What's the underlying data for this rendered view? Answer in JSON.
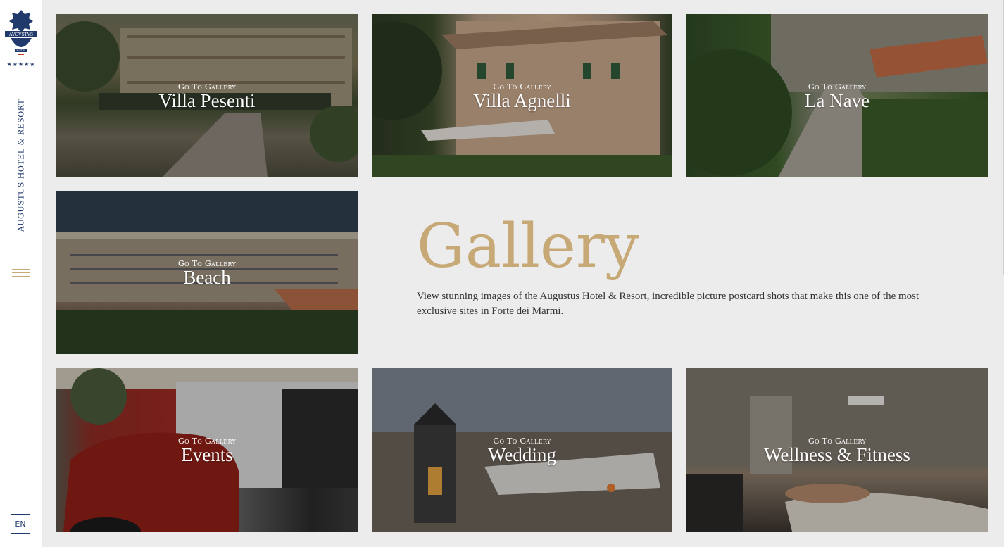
{
  "sidebar": {
    "brand_vertical": "AUGUSTUS HOTEL & RESORT",
    "logo_text": "AVGVSTVS",
    "logo_sub": "HOTEL",
    "stars": "★★★★★",
    "language": "EN",
    "menu_icon": "hamburger-icon"
  },
  "colors": {
    "gold": "#c7a977",
    "navy": "#1f3a6b",
    "page_bg": "#ececec"
  },
  "gallery": {
    "title": "Gallery",
    "description": "View stunning images of the Augustus Hotel & Resort, incredible picture postcard shots that make this one of the most exclusive sites in Forte dei Marmi.",
    "go_label": "Go To Gallery",
    "tiles": [
      {
        "name": "Villa Pesenti"
      },
      {
        "name": "Villa Agnelli"
      },
      {
        "name": "La Nave"
      },
      {
        "name": "Beach"
      },
      {
        "name": "Events"
      },
      {
        "name": "Wedding"
      },
      {
        "name": "Wellness & Fitness"
      }
    ]
  }
}
